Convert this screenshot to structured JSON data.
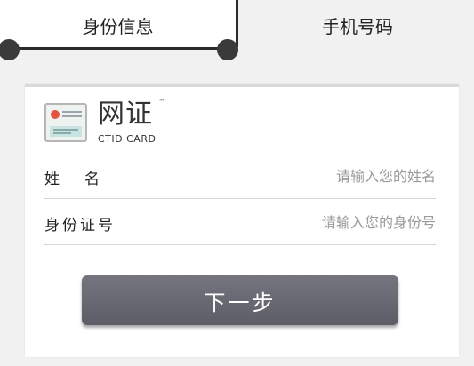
{
  "tabs": [
    {
      "label": "身份信息",
      "active": true
    },
    {
      "label": "手机号码",
      "active": false
    }
  ],
  "card": {
    "logo_title": "网证",
    "logo_tm": "™",
    "logo_subtitle": "CTID CARD",
    "logo_icon": "id-card-icon"
  },
  "form": {
    "name": {
      "label": "姓名",
      "placeholder": "请输入您的姓名",
      "value": ""
    },
    "id_number": {
      "label": "身份证号",
      "placeholder": "请输入您的身份号",
      "value": ""
    }
  },
  "next_button": {
    "label": "下一步"
  },
  "colors": {
    "background": "#f1f1f1",
    "card": "#ffffff",
    "button": "#66666f",
    "placeholder": "#9a9a9a",
    "text": "#222222"
  }
}
